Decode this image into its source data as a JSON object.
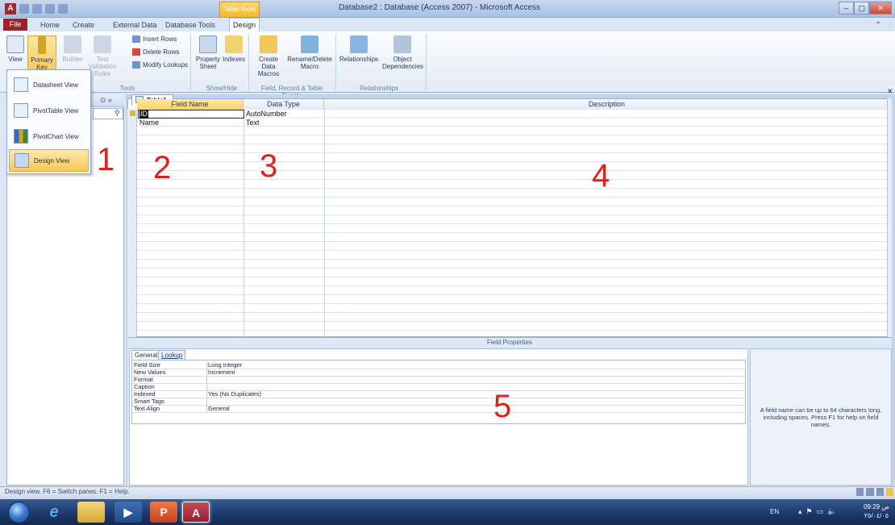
{
  "app": {
    "icon_letter": "A",
    "window_title": "Database2 : Database (Access 2007) - Microsoft Access",
    "context_tab_header": "Table Tools",
    "win_buttons": {
      "minimize": "–",
      "maximize": "▢",
      "close": "✕"
    }
  },
  "tabs": {
    "file": "File",
    "home": "Home",
    "create": "Create",
    "external": "External Data",
    "dbtools": "Database Tools",
    "design": "Design"
  },
  "ribbon": {
    "view": "View",
    "primary_key": "Primary Key",
    "builder": "Builder",
    "test_validation": "Test Validation Rules",
    "insert_rows": "Insert Rows",
    "delete_rows": "Delete Rows",
    "modify_lookups": "Modify Lookups",
    "tools_label": "Tools",
    "property_sheet": "Property Sheet",
    "indexes": "Indexes",
    "showhide_label": "Show/Hide",
    "create_data_macros": "Create Data Macros",
    "rename_delete_macro": "Rename/Delete Macro",
    "field_events_label": "Field, Record & Table Events",
    "relationships": "Relationships",
    "object_dependencies": "Object Dependencies",
    "relationships_label": "Relationships"
  },
  "view_menu": {
    "items": [
      "Datasheet View",
      "PivotTable View",
      "PivotChart View",
      "Design View"
    ],
    "selected": "Design View"
  },
  "document": {
    "tab_name": "Table1",
    "columns": [
      "Field Name",
      "Data Type",
      "Description"
    ],
    "rows": [
      {
        "field_name": "ID",
        "data_type": "AutoNumber",
        "description": ""
      },
      {
        "field_name": "Name",
        "data_type": "Text",
        "description": ""
      }
    ]
  },
  "field_properties": {
    "title": "Field Properties",
    "tabs": [
      "General",
      "Lookup"
    ],
    "rows": [
      {
        "key": "Field Size",
        "value": "Long Integer"
      },
      {
        "key": "New Values",
        "value": "Increment"
      },
      {
        "key": "Format",
        "value": ""
      },
      {
        "key": "Caption",
        "value": ""
      },
      {
        "key": "Indexed",
        "value": "Yes (No Duplicates)"
      },
      {
        "key": "Smart Tags",
        "value": ""
      },
      {
        "key": "Text Align",
        "value": "General"
      }
    ],
    "help": "A field name can be up to 64 characters long, including spaces. Press F1 for help on field names."
  },
  "annotations": [
    "1",
    "2",
    "3",
    "4",
    "5"
  ],
  "status": {
    "text": "Design view.  F6 = Switch panes.  F1 = Help."
  },
  "taskbar": {
    "language": "EN",
    "time": "09:29 ص",
    "date": "٢٥/٠٤/٠٥",
    "apps": [
      "start",
      "internet-explorer",
      "windows-explorer",
      "media-player",
      "powerpoint",
      "access"
    ]
  },
  "colors": {
    "file_tab": "#a31f26",
    "annotation": "#e0201b",
    "selection": "#f6c957",
    "ribbon_bg": "#e3ebf6"
  }
}
